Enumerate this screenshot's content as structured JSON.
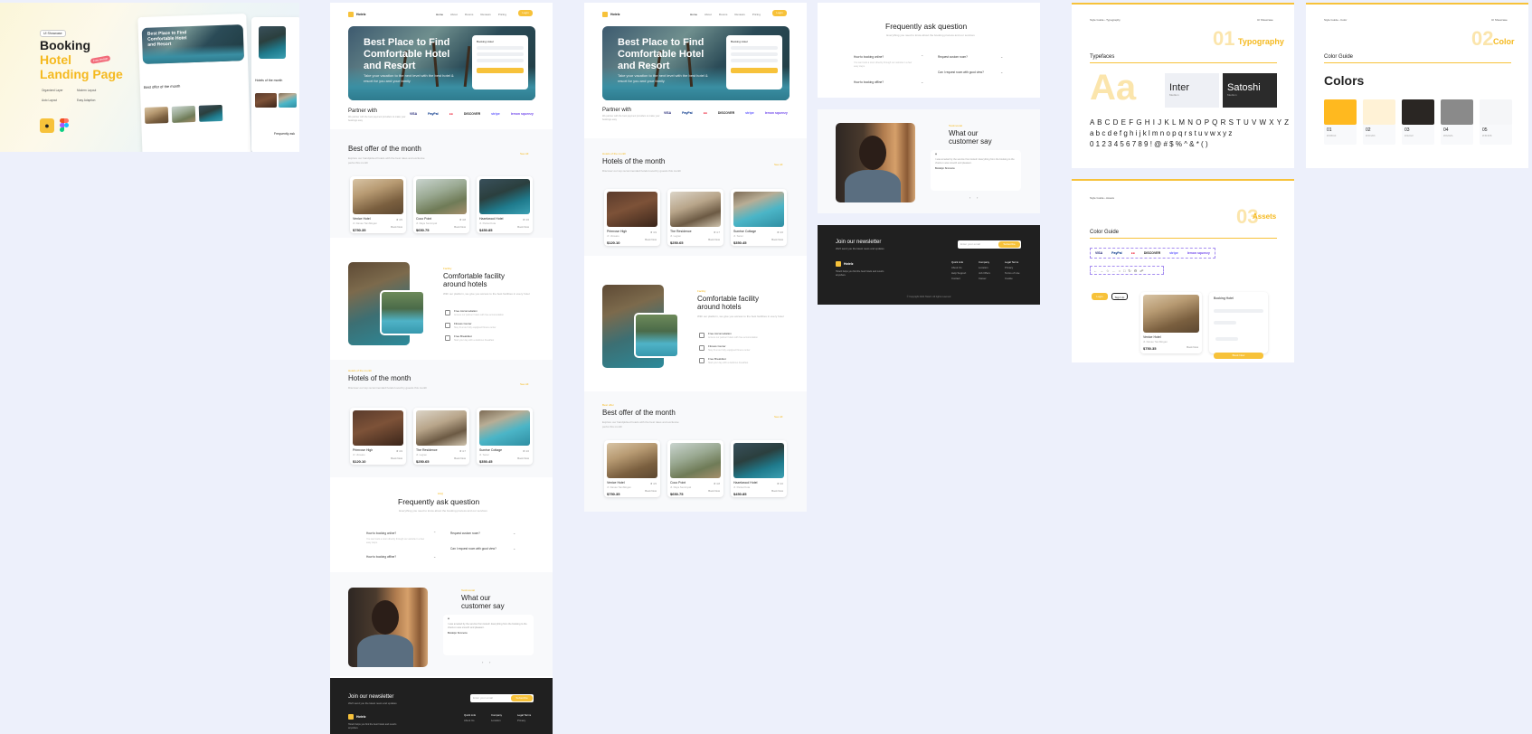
{
  "cover": {
    "badge": "UI Showcase",
    "title_line1": "Booking",
    "title_line2": "Hotel",
    "title_line3": "Landing Page",
    "sticker": "Free Design",
    "features": [
      "Organized Layer",
      "Modern Layout",
      "Auto Layout",
      "Easy Adaption"
    ],
    "thumb_hero": "Best Place to Find Comfortable Hotel and Resort",
    "thumb_section1": "Best offer of the month",
    "thumb_section2": "Hotels of the month",
    "thumb_section3": "Frequently ask"
  },
  "brand": "Hotelz",
  "nav": [
    "Home",
    "About",
    "Rooms",
    "Reviews",
    "Pricing"
  ],
  "nav_button": "Login",
  "hero": {
    "title": "Best Place to Find Comfortable Hotel and Resort",
    "subtitle": "Take your vacation to the next level with the best hotel & resort for you and your family",
    "card_title": "Booking Hotel",
    "card_fields": [
      "Location",
      "Check in",
      "Guests"
    ],
    "card_button": "Book Now"
  },
  "partners": {
    "title": "Partner with",
    "subtitle": "We partner with the best payment providers to make your bookings easy",
    "logos": [
      "VISA",
      "PayPal",
      "●●",
      "DISCOVER",
      "stripe",
      "lemon squeezy"
    ]
  },
  "best_offer": {
    "tag": "Best offer",
    "title": "Best offer of the month",
    "subtitle": "Explore our handpicked hotels with the best rates and exclusive perks this month",
    "see_all": "See All",
    "hotels": [
      {
        "name": "Venice Hotel",
        "loc": "Jl. Danau Tamblingan",
        "price": "$750.35",
        "rating": "★ 4.5",
        "book": "Book Now"
      },
      {
        "name": "Coco Point",
        "loc": "Jl. Raya Seminyak",
        "price": "$650.75",
        "rating": "★ 4.8",
        "book": "Book Now"
      },
      {
        "name": "Hazelwood Hotel",
        "loc": "Jl. Pantai Kuta",
        "price": "$450.85",
        "rating": "★ 4.6",
        "book": "Book Now"
      }
    ]
  },
  "facility": {
    "tag": "Facility",
    "title": "Comfortable facility around hotels",
    "subtitle": "With our platform, we give you access to the best facilities in every hotel",
    "items": [
      {
        "title": "Free Accomodation",
        "desc": "Access our partner hotels with free accomodation"
      },
      {
        "title": "Fitness Center",
        "desc": "Stay fit at our fully equipped fitness center"
      },
      {
        "title": "Free Breakfast",
        "desc": "Start your day with a delicious breakfast"
      }
    ]
  },
  "hotels_month": {
    "tag": "Hotels of the month",
    "title": "Hotels of the month",
    "subtitle": "Discover our top recommended hotels loved by guests this month",
    "see_all": "See All",
    "hotels": [
      {
        "name": "Primrose High",
        "loc": "Jl. Uluwatu",
        "price": "$120.10",
        "rating": "★ 4.9",
        "book": "Book Now"
      },
      {
        "name": "The Residence",
        "loc": "Jl. Legian",
        "price": "$250.65",
        "rating": "★ 4.7",
        "book": "Book Now"
      },
      {
        "name": "Sunrise Cottage",
        "loc": "Jl. Sanur",
        "price": "$350.45",
        "rating": "★ 4.6",
        "book": "Book Now"
      }
    ]
  },
  "faq": {
    "tag": "FAQ",
    "title": "Frequently ask question",
    "subtitle": "Everything you need to know about the booking process and our services",
    "left": [
      {
        "q": "How to booking online?",
        "a": "You can book a room directly through our website in a few easy steps."
      },
      {
        "q": "How to booking offline?",
        "a": ""
      }
    ],
    "right": [
      {
        "q": "Request custom room?",
        "a": ""
      },
      {
        "q": "Can I request room with good view?",
        "a": ""
      }
    ]
  },
  "testimonial": {
    "tag": "Testimonial",
    "title": "What our customer say",
    "quote": "I was amazed by the service from Hotelz. Everything from the booking to the check-in was smooth and pleasant.",
    "author": "Brooklyn Simmons",
    "role": "Traveler"
  },
  "newsletter": {
    "title": "Join our newsletter",
    "subtitle": "We'll send you the latest news and updates",
    "placeholder": "Enter your email",
    "button": "Subscribe",
    "about": "Hotelz helps you find the best hotels and resorts anywhere",
    "cols": [
      {
        "head": "Quick Link",
        "items": [
          "About Us",
          "Help Support",
          "Contact"
        ]
      },
      {
        "head": "Company",
        "items": [
          "Location",
          "Job Offers",
          "Career"
        ]
      },
      {
        "head": "Legal Terms",
        "items": [
          "Privacy",
          "Terms of Use",
          "Cookie"
        ]
      }
    ],
    "copyright": "© Copyright 2024 Hotelz. All rights reserved"
  },
  "guide": {
    "breadcrumb": "Style Guide  ›  Typography",
    "brand_right": "UI Showcase",
    "typography_num": "01",
    "typography_label": "Typography",
    "typefaces": "Typefaces",
    "aa": "Aa",
    "font1": "Inter",
    "font1_sub": "Medium",
    "font2": "Satoshi",
    "font2_sub": "Medium",
    "upper": "A B C D E F G H I J K L M N O P Q R S T U V W X Y Z",
    "lower": "a b c d e f g h i j k l m n o p q r s t u v w x y z",
    "digits": "0 1 2 3 4 5 6 7 8 9  ! @ # $ % ^ & * ( )",
    "color_breadcrumb": "Style Guide  ›  Color",
    "color_num": "02",
    "color_label": "Color",
    "color_guide": "Color Guide",
    "colors_title": "Colors",
    "swatches": [
      {
        "n": "01",
        "hex": "#FFB91F",
        "color": "#ffb91f"
      },
      {
        "n": "02",
        "hex": "#FFF2D6",
        "color": "#fff2d6"
      },
      {
        "n": "03",
        "hex": "#222222",
        "color": "#2a2623"
      },
      {
        "n": "04",
        "hex": "#8A8A8A",
        "color": "#8a8a8a"
      },
      {
        "n": "05",
        "hex": "#F8F9FB",
        "color": "#f5f6f8"
      }
    ],
    "assets_breadcrumb": "Style Guide  ›  Assets",
    "assets_num": "03",
    "assets_label": "Assets",
    "assets_section": "Color Guide",
    "asset_logos": [
      "VISA",
      "PayPal",
      "●●",
      "DISCOVER",
      "stripe",
      "lemon squeezy"
    ],
    "asset_buttons": [
      "Login",
      "Sign Up"
    ],
    "asset_hotel": {
      "name": "Venice Hotel",
      "loc": "Jl. Danau Tamblingan",
      "price": "$750.35",
      "book": "Book Now"
    },
    "asset_form": {
      "title": "Booking Hotel",
      "button": "Book Now"
    }
  }
}
